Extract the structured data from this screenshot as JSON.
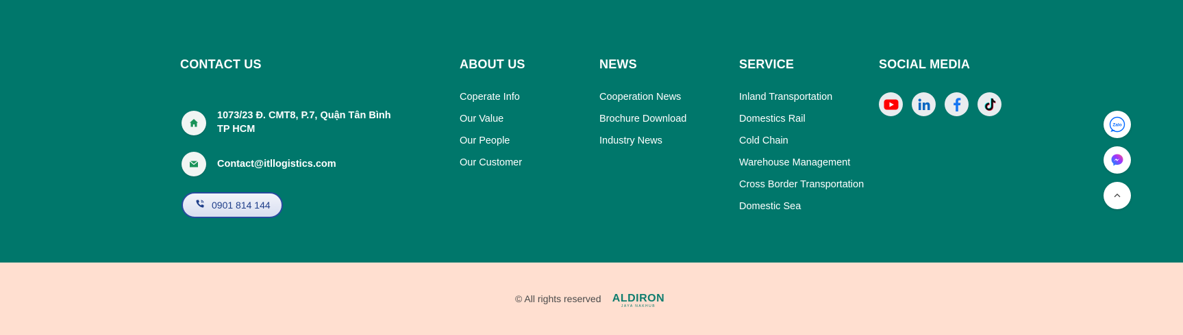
{
  "contact": {
    "title": "CONTACT US",
    "address_line1": "1073/23 Đ. CMT8, P.7, Quận Tân Bình",
    "address_line2": "TP HCM",
    "email": "Contact@itllogistics.com",
    "phone": "0901 814 144",
    "icons": [
      "home-icon",
      "mail-icon",
      "phone-icon"
    ]
  },
  "about": {
    "title": "ABOUT US",
    "items": [
      "Coperate Info",
      "Our Value",
      "Our People",
      "Our Customer"
    ]
  },
  "news": {
    "title": "NEWS",
    "items": [
      "Cooperation News",
      "Brochure Download",
      "Industry News"
    ]
  },
  "service": {
    "title": "SERVICE",
    "items": [
      "Inland Transportation",
      "Domestics Rail",
      "Cold Chain",
      "Warehouse Management",
      "Cross Border Transportation",
      "Domestic Sea"
    ]
  },
  "social": {
    "title": "SOCIAL MEDIA",
    "icons": [
      "youtube-icon",
      "linkedin-icon",
      "facebook-icon",
      "tiktok-icon"
    ]
  },
  "floating": {
    "zalo_text": "Zalo",
    "icons": [
      "zalo-icon",
      "messenger-icon",
      "chevron-up-icon"
    ]
  },
  "bottom": {
    "copyright": "© All rights reserved",
    "logo_main": "ALDIRON",
    "logo_sub": "JAYA NAKHUB"
  },
  "colors": {
    "footer_bg": "#00776b",
    "bottom_bg": "#ffdfd0",
    "phone_accent": "#274a9e",
    "youtube_red": "#ff0000",
    "linkedin_blue": "#0a66c2",
    "facebook_blue": "#1877f2",
    "logo_green": "#0f7d6e"
  }
}
